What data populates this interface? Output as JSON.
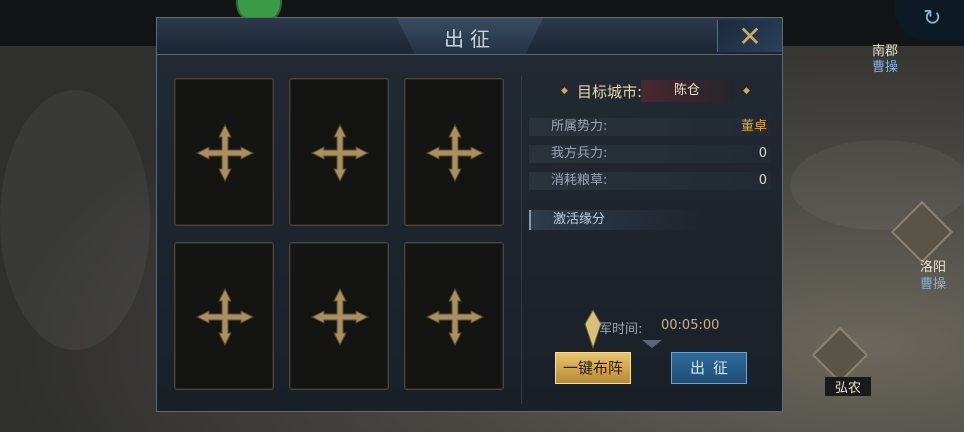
{
  "map": {
    "cities": [
      {
        "name": "洛阳",
        "owner": "曹操"
      },
      {
        "name": "弘农",
        "owner": ""
      }
    ],
    "top_city": {
      "name": "南郡",
      "owner": "曹操"
    }
  },
  "dialog": {
    "title": "出征",
    "close_icon": "close-x-icon",
    "slots": [
      {
        "icon": "plus-icon"
      },
      {
        "icon": "plus-icon"
      },
      {
        "icon": "plus-icon"
      },
      {
        "icon": "plus-icon"
      },
      {
        "icon": "plus-icon"
      },
      {
        "icon": "plus-icon"
      }
    ],
    "target": {
      "label": "目标城市:",
      "value": "陈仓"
    },
    "info": [
      {
        "key": "所属势力:",
        "value": "董卓",
        "accent": "#d7a53c"
      },
      {
        "key": "我方兵力:",
        "value": "0"
      },
      {
        "key": "消耗粮草:",
        "value": "0"
      }
    ],
    "fate_label": "激活缘分",
    "march": {
      "label": "军时间:",
      "value": "00:05:00"
    },
    "auto_button": "一键布阵",
    "go_button": "出征"
  },
  "colors": {
    "gold": "#c9aa62",
    "accent_blue": "#2f6a9a"
  }
}
